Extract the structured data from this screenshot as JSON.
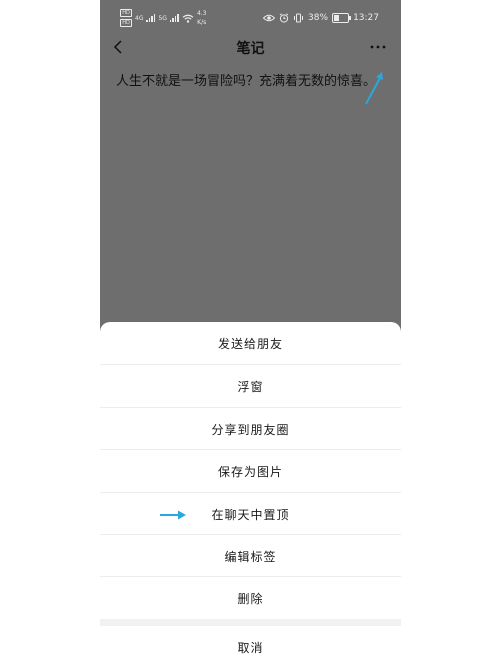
{
  "status_bar": {
    "sim1_badge": "HD",
    "sim2_badge": "HD",
    "network1": "4G",
    "network2": "5G",
    "speed_value": "4.3",
    "speed_unit": "K/s",
    "battery_percent": "38%",
    "battery_level": 0.38,
    "time": "13:27"
  },
  "nav": {
    "title": "笔记"
  },
  "note": {
    "content": "人生不就是一场冒险吗？充满着无数的惊喜。"
  },
  "menu": {
    "items": [
      {
        "label": "发送给朋友"
      },
      {
        "label": "浮窗"
      },
      {
        "label": "分享到朋友圈"
      },
      {
        "label": "保存为图片"
      },
      {
        "label": "在聊天中置顶"
      },
      {
        "label": "编辑标签"
      },
      {
        "label": "删除"
      }
    ],
    "cancel_label": "取消"
  },
  "colors": {
    "overlay": "#6e6e6e",
    "annotation_arrow": "#29a8e0",
    "sheet_background": "#ffffff"
  },
  "icons": {
    "back": "chevron-left-icon",
    "more": "more-dots-icon",
    "wifi": "wifi-icon",
    "eye": "eye-icon",
    "alarm": "alarm-icon",
    "vibrate": "vibrate-icon",
    "battery": "battery-icon"
  }
}
